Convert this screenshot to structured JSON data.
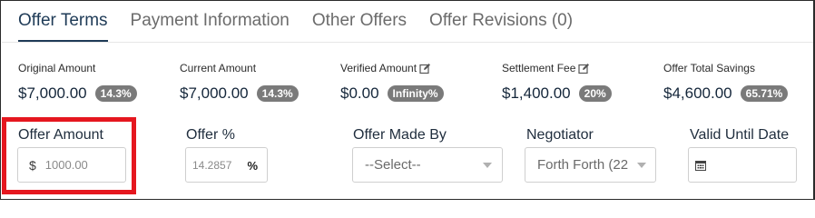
{
  "tabs": [
    {
      "label": "Offer Terms",
      "active": true
    },
    {
      "label": "Payment Information",
      "active": false
    },
    {
      "label": "Other Offers",
      "active": false
    },
    {
      "label": "Offer Revisions (0)",
      "active": false
    }
  ],
  "stats": {
    "original_amount": {
      "label": "Original Amount",
      "value": "$7,000.00",
      "badge": "14.3%"
    },
    "current_amount": {
      "label": "Current Amount",
      "value": "$7,000.00",
      "badge": "14.3%"
    },
    "verified_amount": {
      "label": "Verified Amount",
      "value": "$0.00",
      "badge": "Infinity%",
      "icon": "edit-icon"
    },
    "settlement_fee": {
      "label": "Settlement Fee",
      "value": "$1,400.00",
      "badge": "20%",
      "icon": "edit-icon"
    },
    "offer_total_savings": {
      "label": "Offer Total Savings",
      "value": "$4,600.00",
      "badge": "65.71%"
    }
  },
  "form": {
    "offer_amount": {
      "label": "Offer Amount",
      "prefix": "$",
      "placeholder": "1000.00"
    },
    "offer_percent": {
      "label": "Offer %",
      "placeholder": "14.2857",
      "suffix": "%"
    },
    "offer_made_by": {
      "label": "Offer Made By",
      "selected": "--Select--"
    },
    "negotiator": {
      "label": "Negotiator",
      "selected": "Forth Forth (22"
    },
    "valid_until_date": {
      "label": "Valid Until Date",
      "value": ""
    }
  },
  "colors": {
    "highlight": "#e5171f",
    "active_tab": "#1f3b57",
    "badge": "#7a7a7a"
  }
}
